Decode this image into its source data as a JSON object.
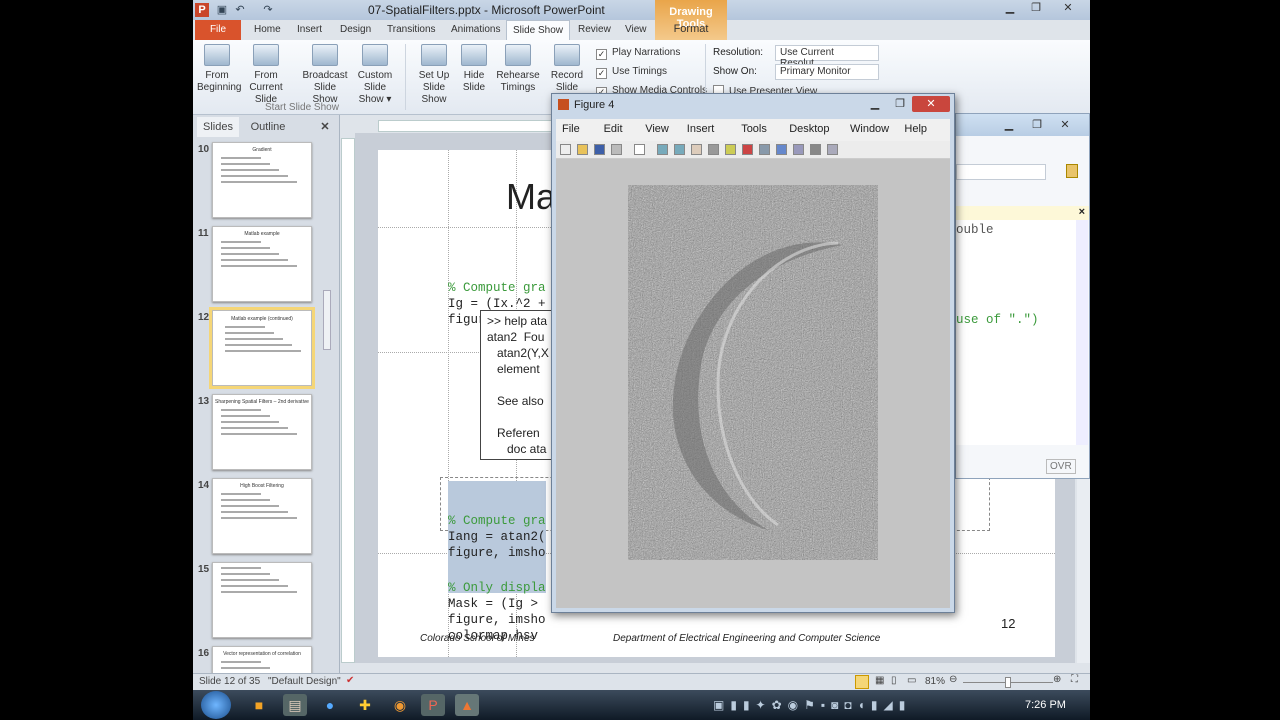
{
  "app": {
    "title": "07-SpatialFilters.pptx - Microsoft PowerPoint",
    "contextual_tab_group": "Drawing Tools",
    "contextual_tab": "Format"
  },
  "tabs": [
    "File",
    "Home",
    "Insert",
    "Design",
    "Transitions",
    "Animations",
    "Slide Show",
    "Review",
    "View"
  ],
  "active_tab": "Slide Show",
  "ribbon": {
    "start_group": "Start Slide Show",
    "buttons": [
      {
        "l1": "From",
        "l2": "Beginning"
      },
      {
        "l1": "From",
        "l2": "Current Slide"
      },
      {
        "l1": "Broadcast",
        "l2": "Slide Show"
      },
      {
        "l1": "Custom",
        "l2": "Slide Show ▾"
      },
      {
        "l1": "Set Up",
        "l2": "Slide Show"
      },
      {
        "l1": "Hide",
        "l2": "Slide"
      },
      {
        "l1": "Rehearse",
        "l2": "Timings"
      },
      {
        "l1": "Record",
        "l2": "Slide Show ▾"
      }
    ],
    "checks": [
      {
        "label": "Play Narrations",
        "checked": true
      },
      {
        "label": "Use Timings",
        "checked": true
      },
      {
        "label": "Show Media Controls",
        "checked": true
      }
    ],
    "resolution_label": "Resolution:",
    "resolution_value": "Use Current Resolut...",
    "show_on_label": "Show On:",
    "show_on_value": "Primary Monitor",
    "presenter_view": "Use Presenter View"
  },
  "panel": {
    "tabs": [
      "Slides",
      "Outline"
    ],
    "close": "✕",
    "thumbs": [
      {
        "num": "10",
        "title": "Gradient"
      },
      {
        "num": "11",
        "title": "Matlab example"
      },
      {
        "num": "12",
        "title": "Matlab example (continued)"
      },
      {
        "num": "13",
        "title": "Sharpening Spatial Filters – 2nd derivative"
      },
      {
        "num": "14",
        "title": "High Boost Filtering"
      },
      {
        "num": "15",
        "title": ""
      },
      {
        "num": "16",
        "title": "Vector representation of correlation"
      }
    ]
  },
  "slide": {
    "title": "Ma",
    "code1": [
      "% Compute gra",
      "Ig = (Ix.^2 +",
      "figure, imsho"
    ],
    "help": [
      ">> help ata",
      "atan2  Fou",
      "   atan2(Y,X",
      "   element",
      "",
      "   See also",
      "",
      "   Referen",
      "      doc ata"
    ],
    "code2": [
      "% Compute gra",
      "Iang = atan2(",
      "figure, imsho"
    ],
    "code3": [
      "% Only displa",
      "Mask = (Ig > ",
      "figure, imsho",
      "colormap hsv"
    ],
    "footer_left": "Colorado School of Mines",
    "footer_center": "Department of Electrical Engineering and Computer Science",
    "page_number": "12"
  },
  "editor": {
    "code_a": "ouble",
    "code_b": "use of \".\")",
    "ovr": "OVR",
    "close": "×"
  },
  "figure": {
    "title": "Figure 4",
    "menu": [
      "File",
      "Edit",
      "View",
      "Insert",
      "Tools",
      "Desktop",
      "Window",
      "Help"
    ]
  },
  "status": {
    "slide": "Slide 12 of 35",
    "theme": "\"Default Design\"",
    "zoom": "81%",
    "zoom_fraction": 0.5
  },
  "taskbar": {
    "clock": "7:26 PM"
  }
}
